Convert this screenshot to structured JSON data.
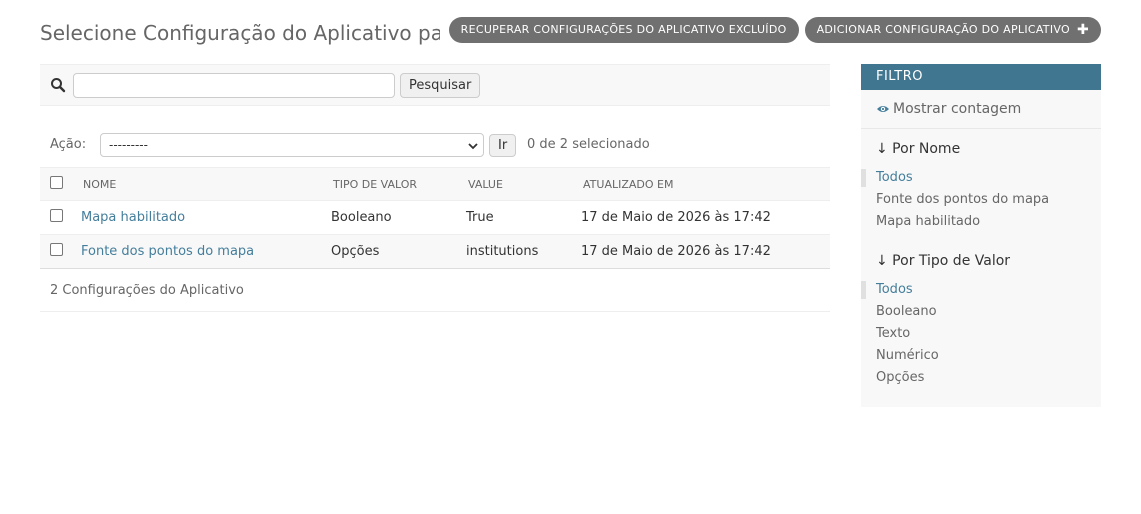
{
  "header": {
    "title": "Selecione Configuração do Aplicativo para modificar",
    "recover_button": "RECUPERAR CONFIGURAÇÕES DO APLICATIVO EXCLUÍDO",
    "add_button": "ADICIONAR CONFIGURAÇÃO DO APLICATIVO"
  },
  "search": {
    "value": "",
    "button": "Pesquisar"
  },
  "actions": {
    "label": "Ação:",
    "selected": "---------",
    "go": "Ir",
    "selection_count": "0 de 2 selecionado"
  },
  "table": {
    "columns": [
      "NOME",
      "TIPO DE VALOR",
      "VALUE",
      "ATUALIZADO EM"
    ],
    "rows": [
      {
        "name": "Mapa habilitado",
        "type": "Booleano",
        "value": "True",
        "updated": "17 de Maio de 2026 às 17:42"
      },
      {
        "name": "Fonte dos pontos do mapa",
        "type": "Opções",
        "value": "institutions",
        "updated": "17 de Maio de 2026 às 17:42"
      }
    ]
  },
  "paginator": "2 Configurações do Aplicativo",
  "filter": {
    "title": "FILTRO",
    "show_count": "Mostrar contagem",
    "groups": [
      {
        "title": "↓ Por Nome",
        "items": [
          "Todos",
          "Fonte dos pontos do mapa",
          "Mapa habilitado"
        ]
      },
      {
        "title": "↓ Por Tipo de Valor",
        "items": [
          "Todos",
          "Booleano",
          "Texto",
          "Numérico",
          "Opções"
        ]
      }
    ]
  },
  "colors": {
    "link": "#447e9b",
    "filter_header": "#417690",
    "tool_button": "#707070"
  }
}
